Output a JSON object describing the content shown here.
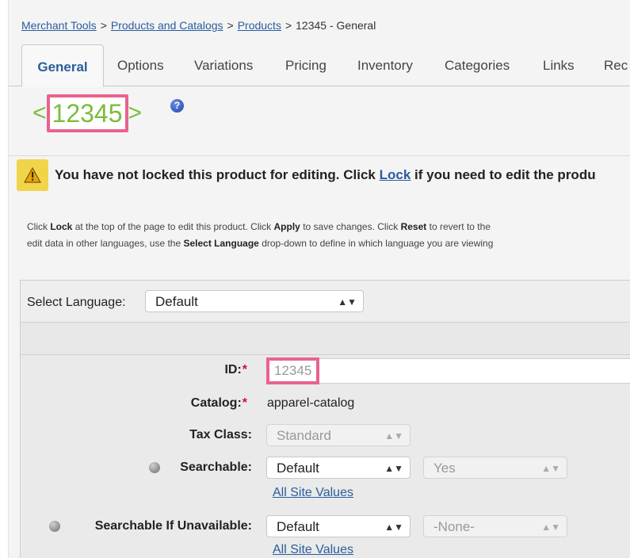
{
  "breadcrumb": {
    "items": [
      "Merchant Tools",
      "Products and Catalogs",
      "Products"
    ],
    "separator": ">",
    "current": "12345 - General"
  },
  "tabs": [
    "General",
    "Options",
    "Variations",
    "Pricing",
    "Inventory",
    "Categories",
    "Links",
    "Rec"
  ],
  "active_tab": "General",
  "product_heading": {
    "open_bracket": "<",
    "id": "12345",
    "close_bracket": ">",
    "help_icon": "help-icon",
    "help_glyph": "?"
  },
  "warning": {
    "icon": "warning-triangle-icon",
    "text_before": "You have not locked this product for editing. Click ",
    "link": "Lock",
    "text_after": " if you need to edit the produ"
  },
  "info": {
    "line1_a": "Click ",
    "line1_b": "Lock",
    "line1_c": " at the top of the page to edit this product. Click ",
    "line1_d": "Apply",
    "line1_e": " to save changes. Click ",
    "line1_f": "Reset",
    "line1_g": " to revert to the",
    "line2_a": "edit data in other languages, use the ",
    "line2_b": "Select Language",
    "line2_c": " drop-down to define in which language you are viewing"
  },
  "form": {
    "language_label": "Select Language:",
    "language_value": "Default",
    "required_mark": "*",
    "id_label": "ID:",
    "id_value": "12345",
    "catalog_label": "Catalog:",
    "catalog_value": "apparel-catalog",
    "tax_label": "Tax Class:",
    "tax_value": "Standard",
    "searchable_label": "Searchable:",
    "searchable_value": "Default",
    "searchable_site_value": "Yes",
    "searchable_link": "All Site Values",
    "unavail_label": "Searchable If Unavailable:",
    "unavail_value": "Default",
    "unavail_site_value": "-None-",
    "unavail_link": "All Site Values",
    "select_arrows": "▲▼"
  },
  "colors": {
    "accent_link": "#2a5d9c",
    "id_green": "#7bbd3c",
    "highlight_pink": "#e8638f",
    "warning_yellow": "#f0d54a",
    "required_red": "#d0103a"
  }
}
